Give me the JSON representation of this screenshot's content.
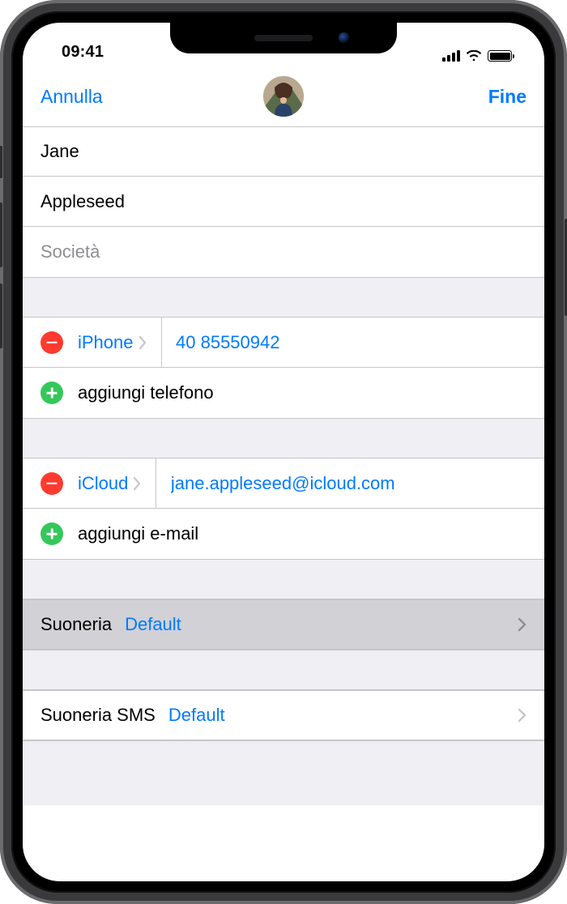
{
  "status": {
    "time": "09:41"
  },
  "nav": {
    "cancel": "Annulla",
    "done": "Fine"
  },
  "name": {
    "first": "Jane",
    "last": "Appleseed",
    "company_placeholder": "Società"
  },
  "phone": {
    "entry": {
      "type": "iPhone",
      "value": "40 85550942"
    },
    "add_label": "aggiungi telefono"
  },
  "email": {
    "entry": {
      "type": "iCloud",
      "value": "jane.appleseed@icloud.com"
    },
    "add_label": "aggiungi e-mail"
  },
  "ringtone": {
    "label": "Suoneria",
    "value": "Default"
  },
  "texttone": {
    "label": "Suoneria SMS",
    "value": "Default"
  }
}
